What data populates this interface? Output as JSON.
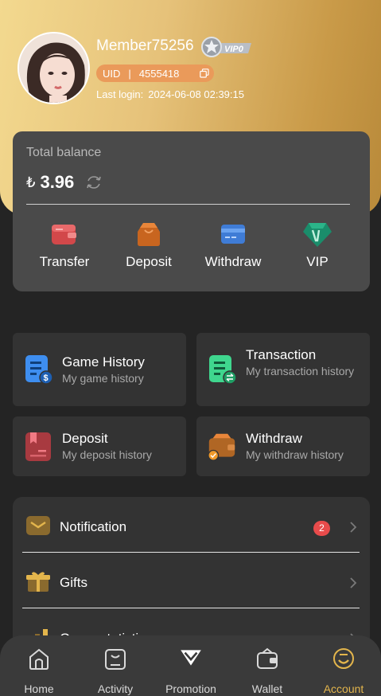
{
  "profile": {
    "username": "Member75256",
    "vip_badge": "VIP0",
    "uid_label": "UID",
    "uid_separator": "|",
    "uid_value": "4555418",
    "last_login_label": "Last login:",
    "last_login_value": "2024-06-08 02:39:15"
  },
  "balance": {
    "label": "Total balance",
    "currency_symbol": "₺",
    "amount": "3.96"
  },
  "actions": [
    {
      "label": "Transfer",
      "icon": "wallet-icon",
      "color": "#e0504f"
    },
    {
      "label": "Deposit",
      "icon": "bag-icon",
      "color": "#e07a2a"
    },
    {
      "label": "Withdraw",
      "icon": "card-icon",
      "color": "#4a8fe8"
    },
    {
      "label": "VIP",
      "icon": "gem-icon",
      "color": "#1f9e78"
    }
  ],
  "tiles": [
    {
      "title": "Game History",
      "subtitle": "My game history",
      "icon": "game-history-icon"
    },
    {
      "title": "Transaction",
      "subtitle": "My transaction history",
      "icon": "transaction-icon"
    },
    {
      "title": "Deposit",
      "subtitle": "My deposit history",
      "icon": "deposit-history-icon"
    },
    {
      "title": "Withdraw",
      "subtitle": "My withdraw history",
      "icon": "withdraw-history-icon"
    }
  ],
  "menu": {
    "notification": {
      "label": "Notification",
      "badge": "2"
    },
    "gifts": {
      "label": "Gifts"
    },
    "stats": {
      "label": "Game statistics"
    }
  },
  "tabbar": {
    "items": [
      {
        "label": "Home",
        "icon": "home-icon"
      },
      {
        "label": "Activity",
        "icon": "activity-icon"
      },
      {
        "label": "Promotion",
        "icon": "promotion-icon"
      },
      {
        "label": "Wallet",
        "icon": "wallet-tab-icon"
      },
      {
        "label": "Account",
        "icon": "account-icon"
      }
    ],
    "active": "Account"
  },
  "colors": {
    "gold": "#e3b54c",
    "card_bg": "#4a4a4a",
    "tile_bg": "#333333",
    "page_bg": "#242424",
    "badge_red": "#e84b4b"
  }
}
